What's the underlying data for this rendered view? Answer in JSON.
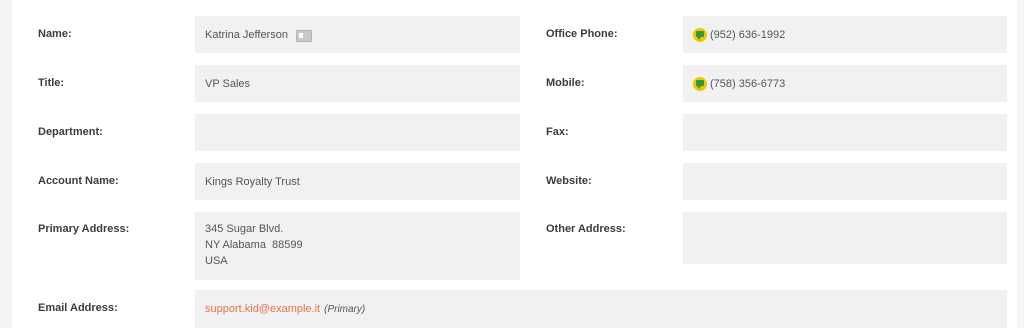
{
  "left": {
    "name": {
      "label": "Name:",
      "value": "Katrina Jefferson"
    },
    "title": {
      "label": "Title:",
      "value": "VP Sales"
    },
    "department": {
      "label": "Department:",
      "value": ""
    },
    "account_name": {
      "label": "Account Name:",
      "value": "Kings Royalty Trust"
    },
    "primary_address": {
      "label": "Primary Address:",
      "lines": [
        "345 Sugar Blvd.",
        "NY Alabama  88599",
        "USA"
      ]
    },
    "email": {
      "label": "Email Address:",
      "value": "support.kid@example.it",
      "tag": "(Primary)"
    }
  },
  "right": {
    "office_phone": {
      "label": "Office Phone:",
      "value": "(952) 636-1992"
    },
    "mobile": {
      "label": "Mobile:",
      "value": "(758) 356-6773"
    },
    "fax": {
      "label": "Fax:",
      "value": ""
    },
    "website": {
      "label": "Website:",
      "value": ""
    },
    "other_address": {
      "label": "Other Address:",
      "value": ""
    }
  },
  "icons": {
    "vcard": "vcard-icon",
    "phone": "phone-icon"
  },
  "colors": {
    "email_link": "#e8704f",
    "phone_icon_bg": "#f2c500",
    "phone_icon_fg": "#2f9a3a",
    "field_bg": "#f2f1f1"
  }
}
